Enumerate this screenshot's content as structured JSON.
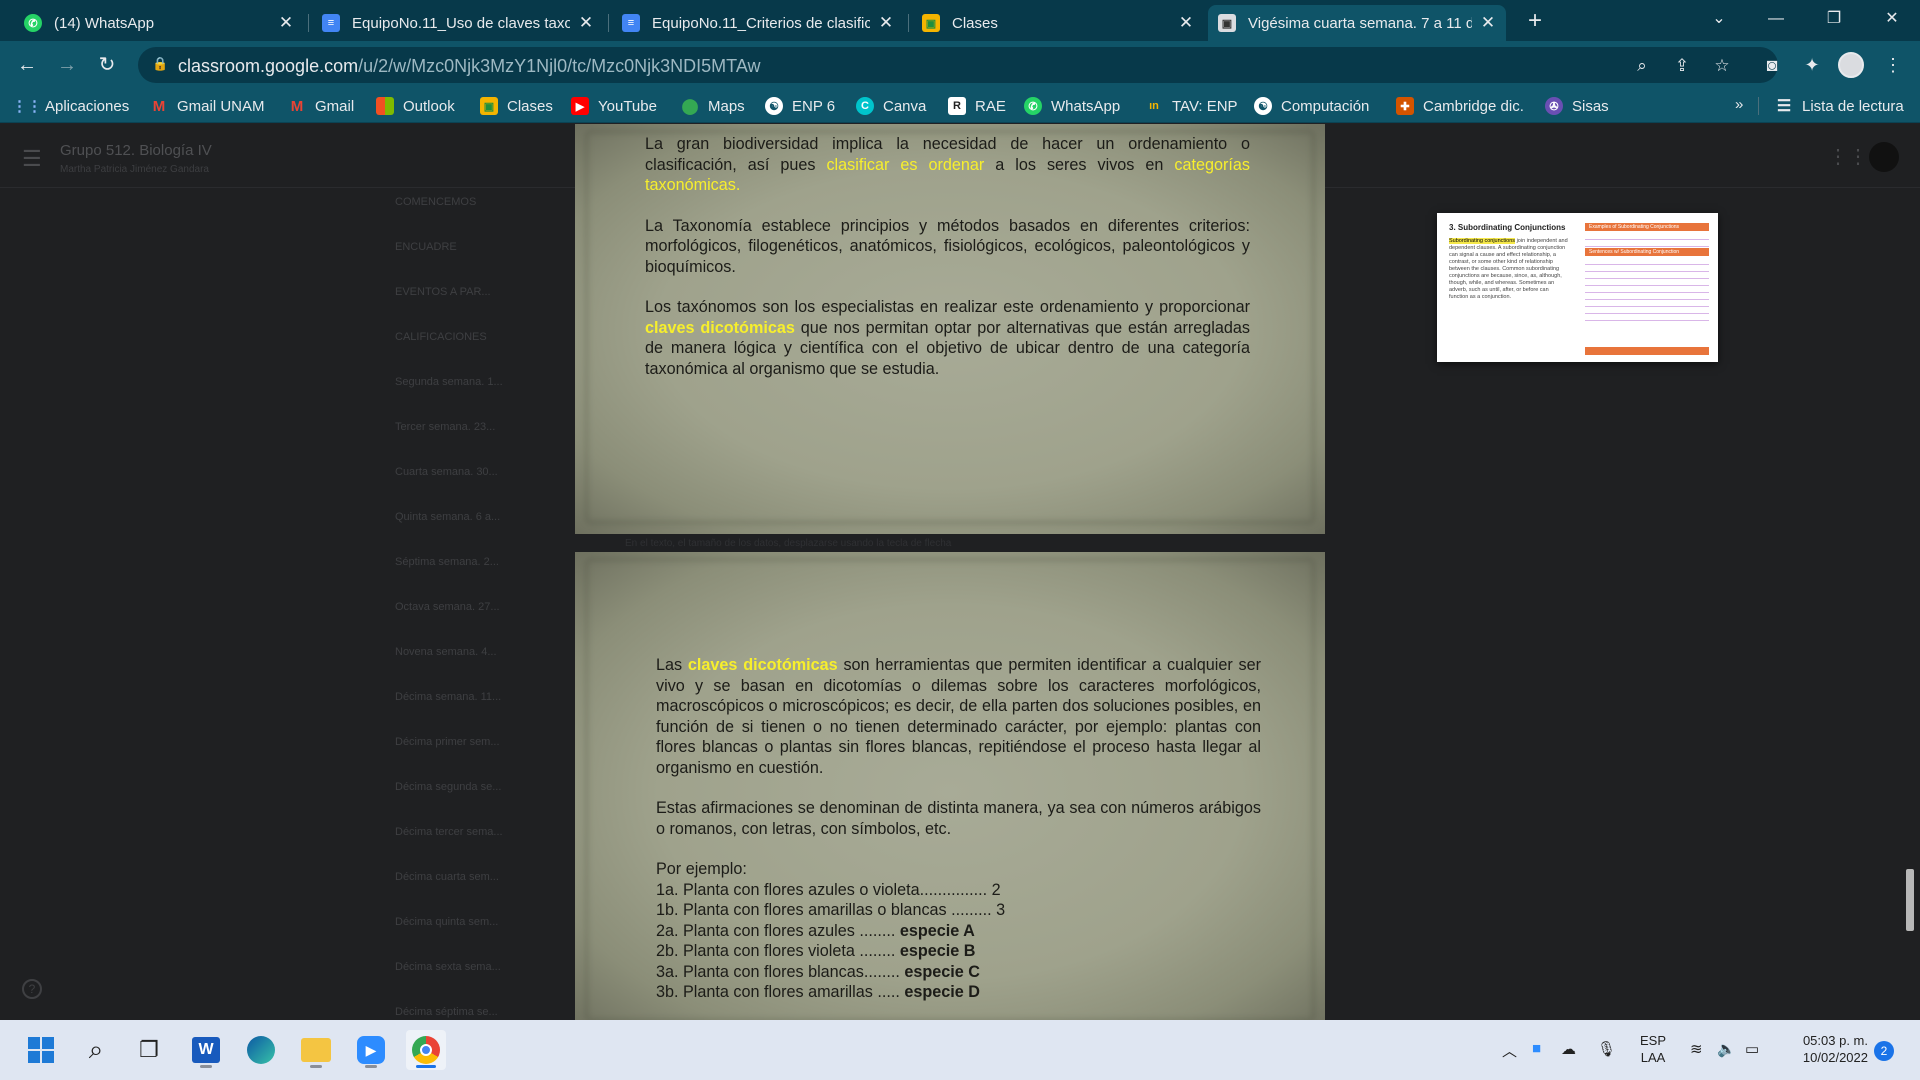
{
  "browser": {
    "tabs": [
      {
        "title": "(14) WhatsApp",
        "icon": "whatsapp-icon"
      },
      {
        "title": "EquipoNo.11_Uso de claves taxon",
        "icon": "google-docs-icon"
      },
      {
        "title": "EquipoNo.11_Criterios de clasific",
        "icon": "google-docs-icon"
      },
      {
        "title": "Clases",
        "icon": "classroom-icon"
      },
      {
        "title": "Vigésima cuarta semana. 7 a 11 d",
        "icon": "classroom-icon"
      }
    ],
    "url_host": "classroom.google.com",
    "url_path": "/u/2/w/Mzc0Njk3MzY1Njl0/tc/Mzc0Njk3NDI5MTAw",
    "bookmarks": [
      "Aplicaciones",
      "Gmail UNAM",
      "Gmail",
      "Outlook",
      "Clases",
      "YouTube",
      "Maps",
      "ENP 6",
      "Canva",
      "RAE",
      "WhatsApp",
      "TAV: ENP",
      "Computación",
      "Cambridge dic.",
      "Sisas"
    ],
    "reading_list": "Lista de lectura",
    "bookmarks_more": "»"
  },
  "classroom": {
    "class_name": "Grupo 512. Biología IV",
    "teacher": "Martha Patricia Jiménez Gandara",
    "topics": [
      "COMENCEMOS",
      "ENCUADRE",
      "EVENTOS A PAR...",
      "CALIFICACIONES",
      "Segunda semana. 1...",
      "Tercer semana. 23...",
      "Cuarta semana. 30...",
      "Quinta semana. 6 a...",
      "Séptima semana. 2...",
      "Octava semana. 27...",
      "Novena semana. 4...",
      "Décima semana. 11...",
      "Décima primer sem...",
      "Décima segunda se...",
      "Décima tercer sema...",
      "Décima cuarta sem...",
      "Décima quinta sem...",
      "Décima sexta sema...",
      "Décima séptima se..."
    ]
  },
  "slide1": {
    "p1_a": "La gran biodiversidad implica la necesidad de hacer un ordenamiento o clasificación, así pues ",
    "p1_hl1": "clasificar es ordenar",
    "p1_b": " a los seres vivos en ",
    "p1_hl2": "categorías taxonómicas.",
    "p2": "La Taxonomía establece principios y métodos basados en diferentes criterios: morfológicos, filogenéticos, anatómicos, fisiológicos, ecológicos, paleontológicos y bioquímicos.",
    "p3_a": "Los taxónomos son los especialistas en realizar este ordenamiento y proporcionar ",
    "p3_hl": "claves dicotómicas",
    "p3_b": " que nos permitan optar por alternativas que están arregladas de manera lógica y científica con el objetivo de ubicar dentro de una categoría taxonómica al organismo que se estudia."
  },
  "slide_gap_note": "En el texto, el tamaño de los datos, desplazarse usando la tecla de flecha",
  "slide2": {
    "p1_a": "Las ",
    "p1_hl": "claves dicotómicas",
    "p1_b": " son herramientas que permiten identificar a cualquier ser vivo y se basan en dicotomías o dilemas sobre los caracteres morfológicos, macroscópicos o microscópicos; es decir, de ella parten dos soluciones posibles, en función de si tienen o no tienen determinado carácter, por ejemplo: plantas con flores blancas o plantas sin flores blancas, repitiéndose el proceso hasta llegar al organismo en cuestión.",
    "p2": "Estas afirmaciones se denominan de distinta manera, ya sea con números arábigos o romanos, con letras, con símbolos, etc.",
    "example_label": "Por ejemplo:",
    "examples": [
      {
        "text": "1a. Planta con flores azules o violeta............... 2",
        "bold": ""
      },
      {
        "text": "1b. Planta con flores amarillas o blancas ......... 3",
        "bold": ""
      },
      {
        "text": "2a. Planta con flores azules ........ ",
        "bold": "especie A"
      },
      {
        "text": "2b. Planta con flores violeta ........ ",
        "bold": "especie B"
      },
      {
        "text": "3a. Planta con flores blancas........ ",
        "bold": "especie C"
      },
      {
        "text": "3b. Planta con flores amarillas ..... ",
        "bold": "especie D"
      }
    ]
  },
  "thumbnail": {
    "title": "3. Subordinating Conjunctions",
    "highlight": "Subordinating conjunctions",
    "body": " join independent and dependent clauses. A subordinating conjunction can signal a cause and effect relationship, a contrast, or some other kind of relationship between the clauses. Common subordinating conjunctions are because, since, as, although, though, while, and whereas. Sometimes an adverb, such as until, after, or before can function as a conjunction.",
    "band1": "Examples of Subordinating Conjunctions",
    "band2": "Sentences w/ Subordinating Conjunction"
  },
  "taskbar": {
    "lang_top": "ESP",
    "lang_bottom": "LAA",
    "time": "05:03 p. m.",
    "date": "10/02/2022",
    "notifications": "2"
  },
  "colors": {
    "tab_strip": "#07394a",
    "toolbar": "#0f5468",
    "highlight_yellow": "#f7ef2c",
    "slide_paper": "#a8ab97"
  }
}
